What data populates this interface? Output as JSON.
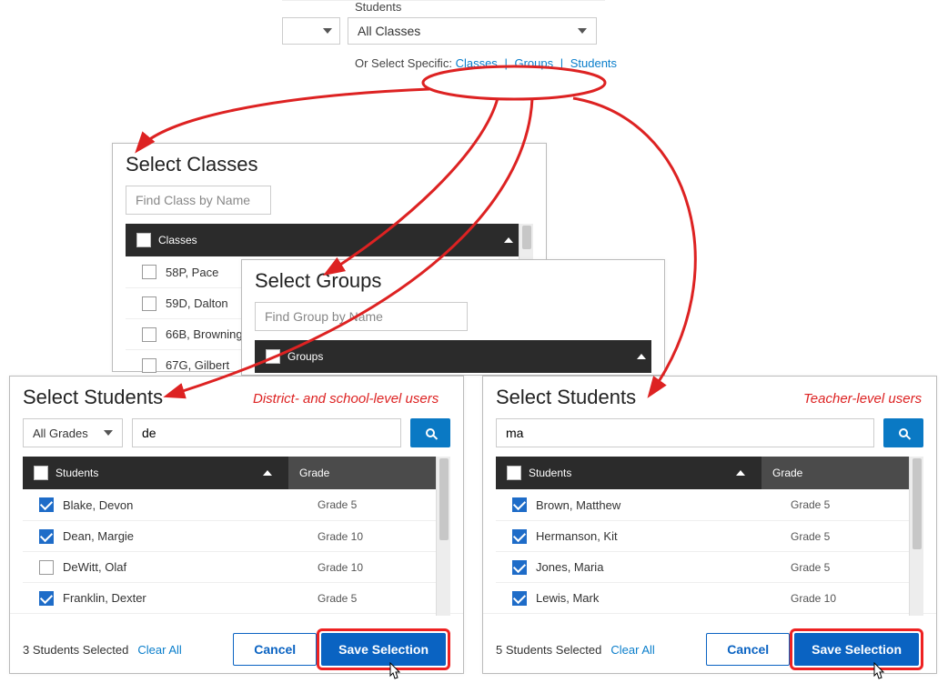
{
  "top": {
    "students_label": "Students",
    "dropdown_value": "All Classes",
    "select_prefix": "Or Select Specific:",
    "link_classes": "Classes",
    "link_groups": "Groups",
    "link_students": "Students"
  },
  "annot": {
    "district": "District- and school-level users",
    "teacher": "Teacher-level users"
  },
  "classes": {
    "title": "Select Classes",
    "find_placeholder": "Find Class by Name",
    "header": "Classes",
    "items": [
      {
        "name": "58P, Pace"
      },
      {
        "name": "59D, Dalton"
      },
      {
        "name": "66B, Browning"
      },
      {
        "name": "67G, Gilbert"
      }
    ]
  },
  "groups": {
    "title": "Select Groups",
    "find_placeholder": "Find Group by Name",
    "header": "Groups"
  },
  "students_left": {
    "title": "Select Students",
    "grades": "All Grades",
    "search_value": "de",
    "header_col1": "Students",
    "header_col2": "Grade",
    "rows": [
      {
        "name": "Blake, Devon",
        "grade": "Grade 5",
        "checked": true
      },
      {
        "name": "Dean, Margie",
        "grade": "Grade 10",
        "checked": true
      },
      {
        "name": "DeWitt, Olaf",
        "grade": "Grade 10",
        "checked": false
      },
      {
        "name": "Franklin, Dexter",
        "grade": "Grade 5",
        "checked": true
      }
    ],
    "selected_text": "3 Students Selected",
    "clear_all": "Clear All",
    "cancel": "Cancel",
    "save": "Save Selection"
  },
  "students_right": {
    "title": "Select Students",
    "search_value": "ma",
    "header_col1": "Students",
    "header_col2": "Grade",
    "rows": [
      {
        "name": "Brown, Matthew",
        "grade": "Grade 5",
        "checked": true
      },
      {
        "name": "Hermanson, Kit",
        "grade": "Grade 5",
        "checked": true
      },
      {
        "name": "Jones, Maria",
        "grade": "Grade 5",
        "checked": true
      },
      {
        "name": "Lewis, Mark",
        "grade": "Grade 10",
        "checked": true
      }
    ],
    "selected_text": "5 Students Selected",
    "clear_all": "Clear All",
    "cancel": "Cancel",
    "save": "Save Selection"
  }
}
